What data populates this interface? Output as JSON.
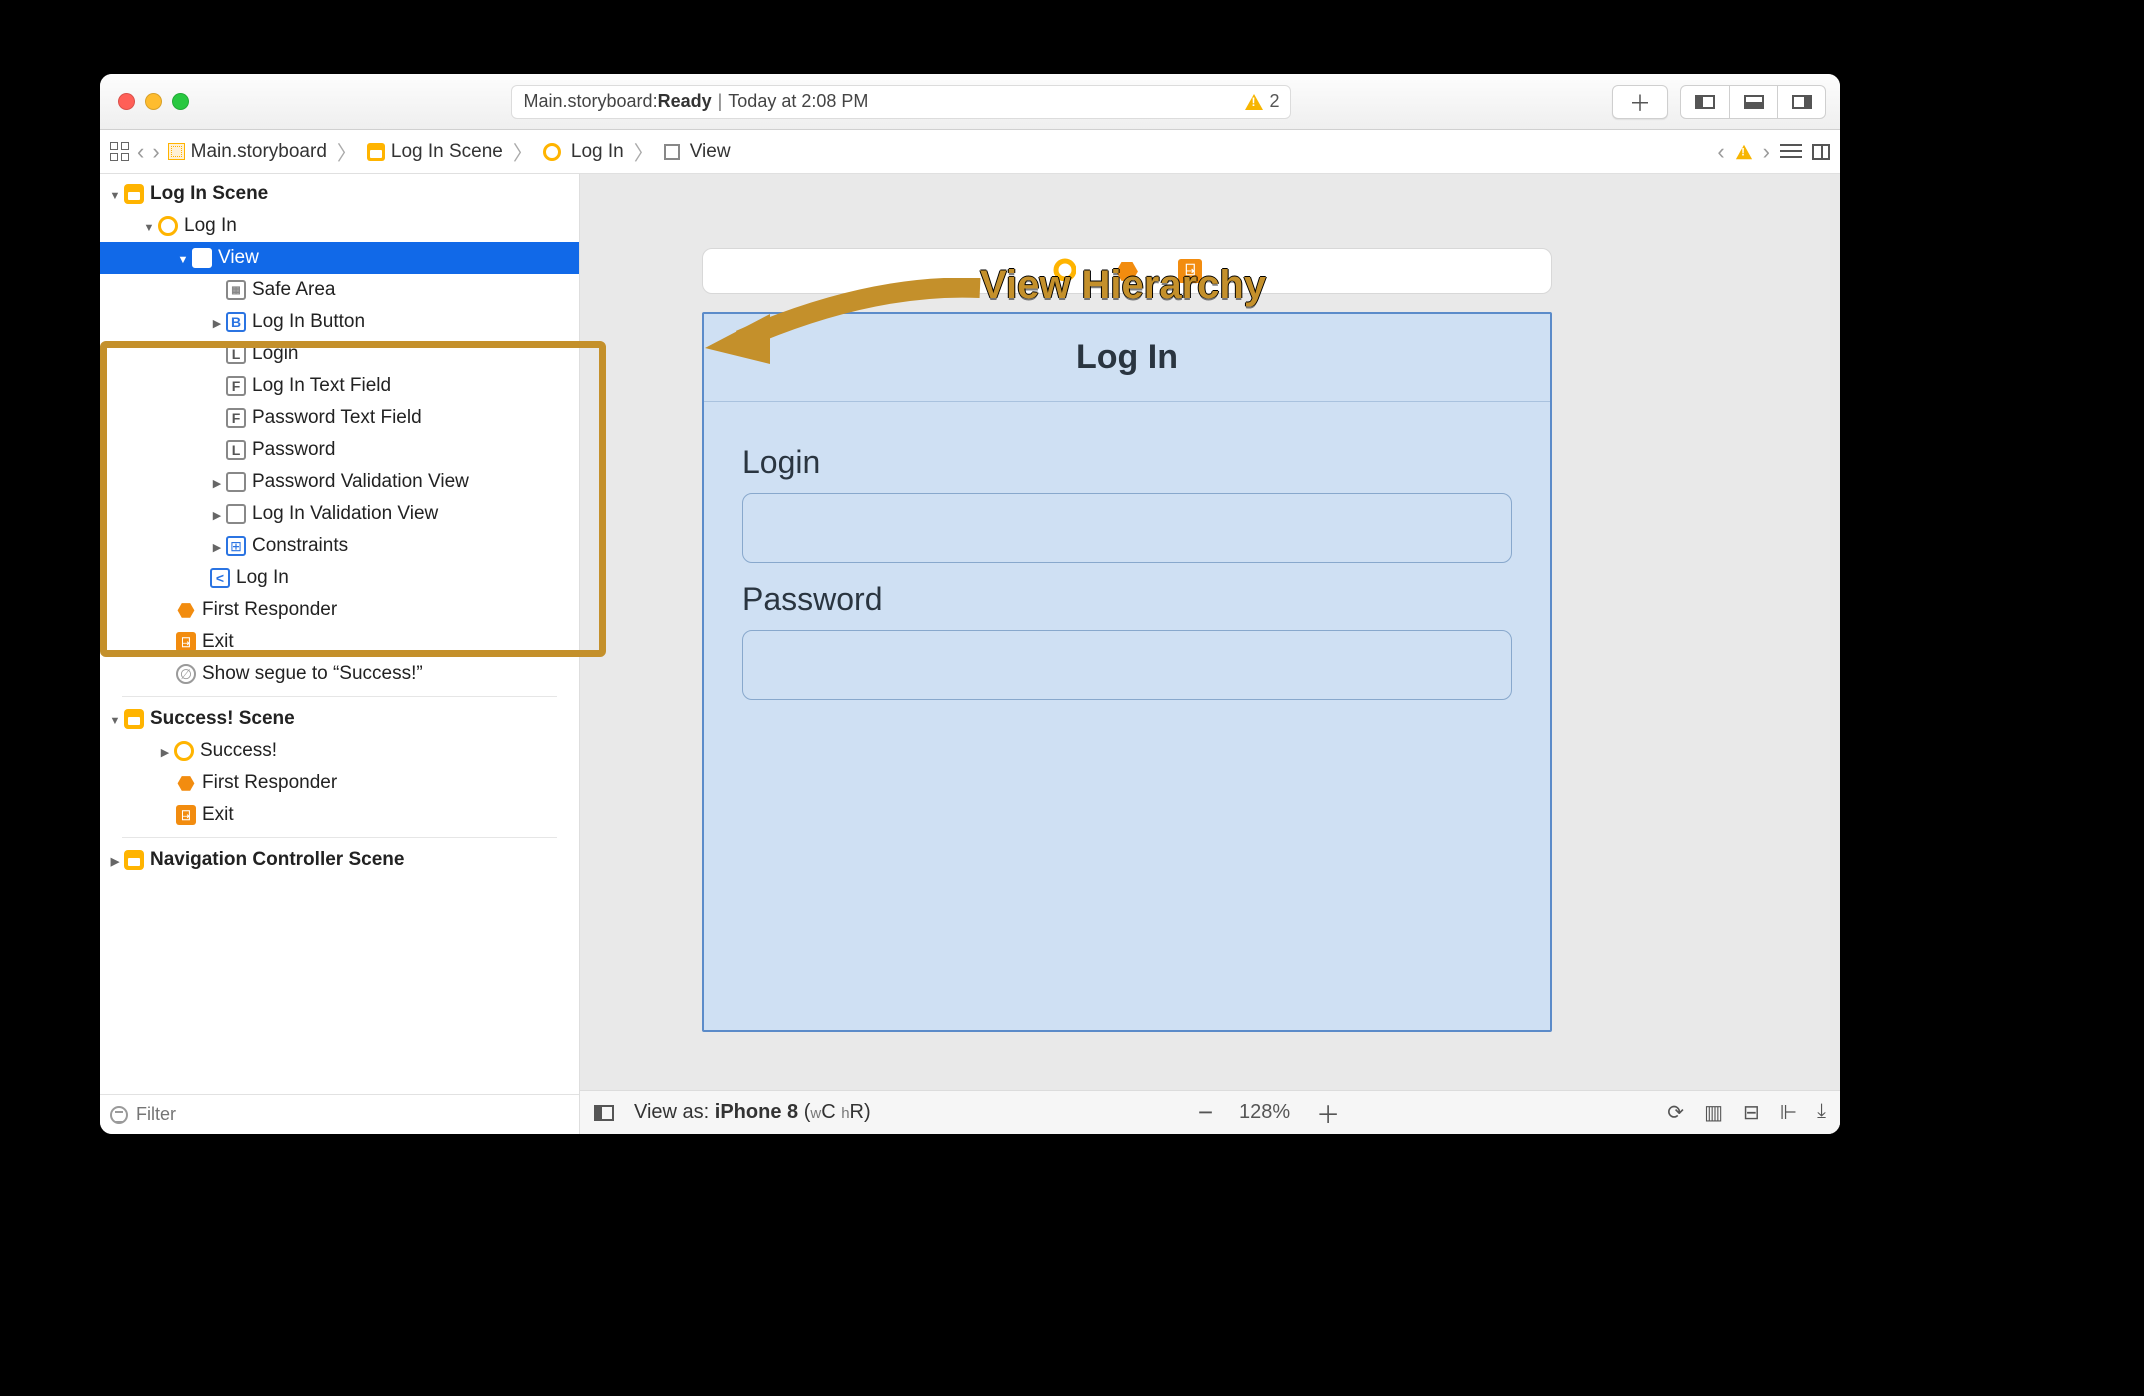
{
  "titlebar": {
    "filename": "Main.storyboard",
    "status": "Ready",
    "timestamp": "Today at 2:08 PM",
    "warning_count": "2"
  },
  "pathbar": {
    "seg1": "Main.storyboard",
    "seg2": "Log In Scene",
    "seg3": "Log In",
    "seg4": "View"
  },
  "outline": {
    "scene1": "Log In Scene",
    "s1_vc": "Log In",
    "s1_view": "View",
    "s1_safe": "Safe Area",
    "s1_btn": "Log In Button",
    "s1_login_lbl": "Login",
    "s1_login_tf": "Log In Text Field",
    "s1_pw_tf": "Password Text Field",
    "s1_pw_lbl": "Password",
    "s1_pw_valid": "Password Validation View",
    "s1_login_valid": "Log In Validation View",
    "s1_cons": "Constraints",
    "s1_navitem": "Log In",
    "s1_fr": "First Responder",
    "s1_exit": "Exit",
    "s1_segue": "Show segue to “Success!”",
    "scene2": "Success! Scene",
    "s2_vc": "Success!",
    "s2_fr": "First Responder",
    "s2_exit": "Exit",
    "scene3": "Navigation Controller Scene",
    "filter_placeholder": "Filter"
  },
  "canvas": {
    "title": "Log In",
    "login_label": "Login",
    "password_label": "Password",
    "view_as_prefix": "View as: ",
    "device": "iPhone 8",
    "trait_open": " (",
    "trait_w": "w",
    "trait_c": "C ",
    "trait_h": "h",
    "trait_r": "R",
    "trait_close": ")",
    "zoom": "128%"
  },
  "annotation": {
    "label": "View Hierarchy"
  }
}
